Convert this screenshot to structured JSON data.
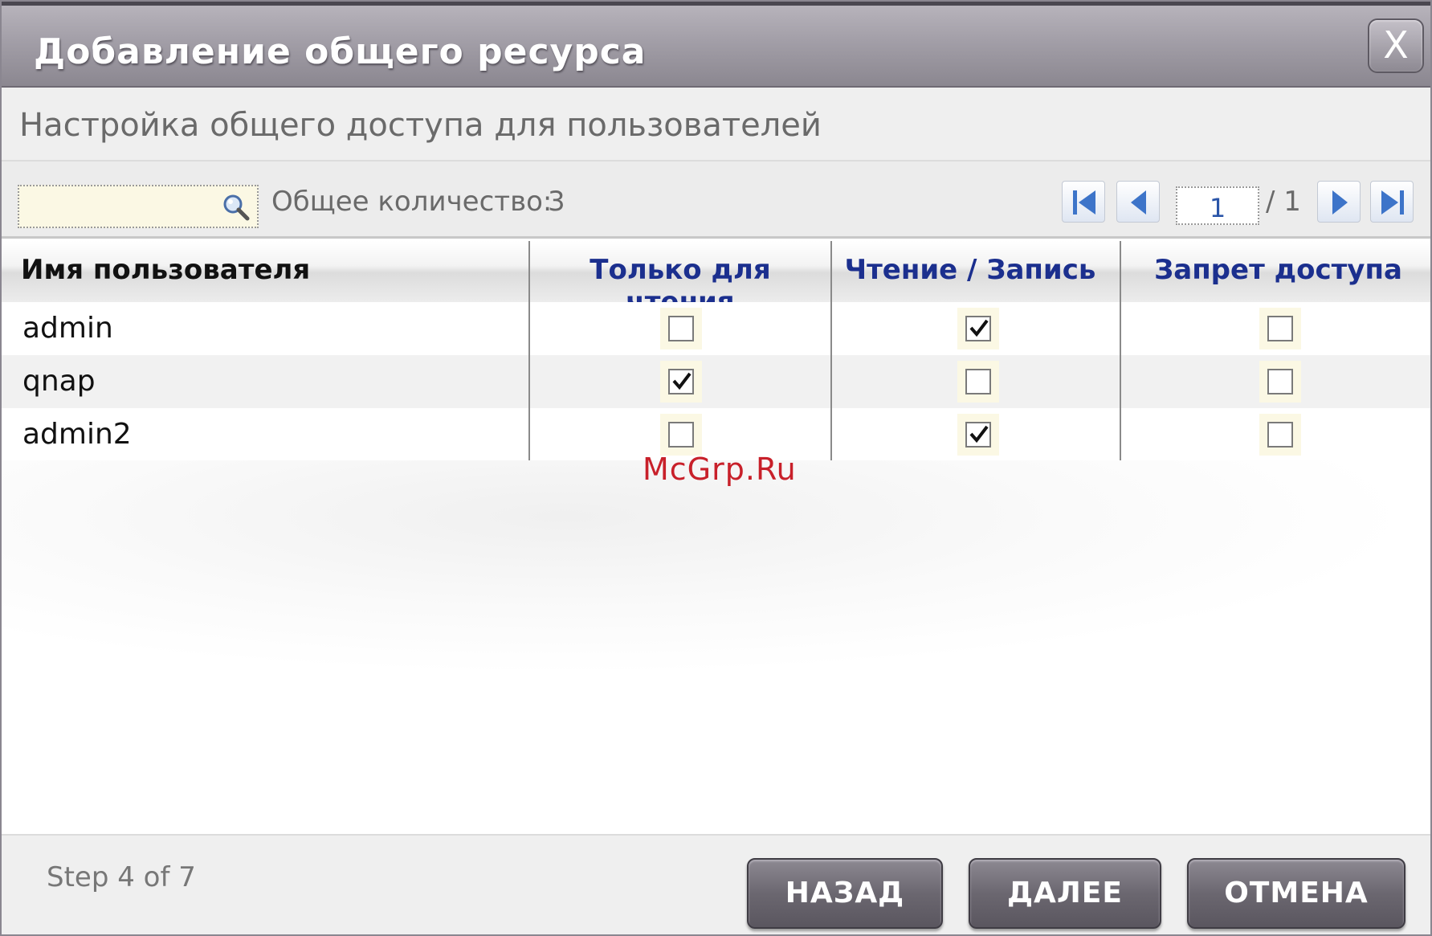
{
  "dialog": {
    "title": "Добавление общего ресурса",
    "close_label": "X",
    "subtitle": "Настройка общего доступа для пользователей"
  },
  "toolbar": {
    "search_value": "",
    "total_label": "Общее количество:",
    "total_count": "3",
    "page_value": "1",
    "page_total": "/ 1"
  },
  "table": {
    "headers": {
      "user": "Имя пользователя",
      "read_only": "Только для чтения",
      "read_write": "Чтение / Запись",
      "deny": "Запрет доступа"
    },
    "rows": [
      {
        "user": "admin",
        "read_only": false,
        "read_write": true,
        "deny": false
      },
      {
        "user": "qnap",
        "read_only": true,
        "read_write": false,
        "deny": false
      },
      {
        "user": "admin2",
        "read_only": false,
        "read_write": true,
        "deny": false
      }
    ]
  },
  "watermark": "McGrp.Ru",
  "footer": {
    "step": "Step 4 of 7",
    "back_label": "НАЗАД",
    "next_label": "ДАЛЕЕ",
    "cancel_label": "ОТМЕНА"
  },
  "colors": {
    "header_text": "#1b2f8e",
    "accent_blue": "#2a55a8",
    "watermark": "#c8202a"
  }
}
